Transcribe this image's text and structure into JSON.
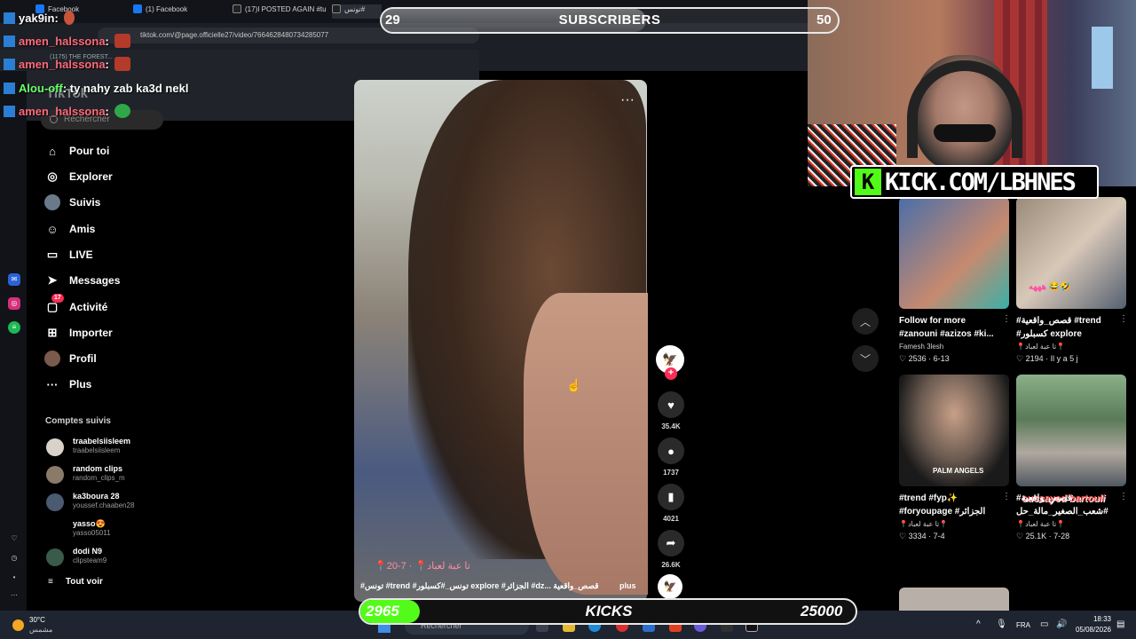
{
  "browser": {
    "tabs": [
      {
        "label": "Facebook",
        "color": "#1877f2"
      },
      {
        "label": "(1) Facebook",
        "color": "#1877f2"
      },
      {
        "label": "(17)I POSTED AGAIN #tu",
        "color": "#ffffff"
      },
      {
        "label": "تونس#",
        "color": "#ffffff"
      }
    ],
    "url": "tiktok.com/@page.officielle27/video/7664628480734285077",
    "bookmark": "(1175) THE FOREST..."
  },
  "chat": [
    {
      "user": "yak9in",
      "text": "",
      "user_color": "#ffffff",
      "emote_color": "#c8553a"
    },
    {
      "user": "amen_halssona",
      "text": "",
      "user_color": "#ff6a7a",
      "emote_color": "#b43a2a"
    },
    {
      "user": "amen_halssona",
      "text": "",
      "user_color": "#ff6a7a",
      "emote_color": "#b43a2a"
    },
    {
      "user": "Alou-off",
      "text": "ty nahy zab ka3d nekl",
      "user_color": "#6bff6b",
      "emote_color": ""
    },
    {
      "user": "amen_halssona",
      "text": "",
      "user_color": "#ff6a7a",
      "emote_color": "#2fa84a"
    }
  ],
  "overlay": {
    "subscribers": {
      "current": "29",
      "label": "SUBSCRIBERS",
      "goal": "50",
      "progress": 0.58
    },
    "kicks": {
      "current": "2965",
      "label": "KICKS",
      "goal": "25000",
      "progress": 0.12
    },
    "kick_url": "KICK.COM/LBHNES",
    "kick_logo": "K"
  },
  "tiktok": {
    "logo": "TikTok",
    "search_placeholder": "Rechercher",
    "nav": [
      {
        "icon": "home-icon",
        "glyph": "⌂",
        "label": "Pour toi"
      },
      {
        "icon": "compass-icon",
        "glyph": "◎",
        "label": "Explorer"
      },
      {
        "icon": "following-icon",
        "glyph": "●",
        "label": "Suivis"
      },
      {
        "icon": "friends-icon",
        "glyph": "☺",
        "label": "Amis"
      },
      {
        "icon": "live-icon",
        "glyph": "▭",
        "label": "LIVE"
      },
      {
        "icon": "messages-icon",
        "glyph": "➤",
        "label": "Messages"
      },
      {
        "icon": "activity-icon",
        "glyph": "▢",
        "label": "Activité",
        "badge": "17"
      },
      {
        "icon": "upload-icon",
        "glyph": "⊞",
        "label": "Importer"
      },
      {
        "icon": "profile-icon",
        "glyph": "●",
        "label": "Profil"
      },
      {
        "icon": "more-icon",
        "glyph": "···",
        "label": "Plus"
      }
    ],
    "following_title": "Comptes suivis",
    "accounts": [
      {
        "name": "traabelsiisleem",
        "handle": "traabelsiisleem",
        "color": "#d9d2c8"
      },
      {
        "name": "random clips",
        "handle": "random_clips_m",
        "color": "#8a7a6a"
      },
      {
        "name": "ka3boura 28",
        "handle": "youssef.chaaben28",
        "color": "#4a5a70"
      },
      {
        "name": "yasso😍",
        "handle": "yasso05011",
        "color": "#000000"
      },
      {
        "name": "dodi N9",
        "handle": "clipsteam9",
        "color": "#3a5a4a"
      }
    ],
    "see_all": "Tout voir",
    "video": {
      "caption": "📍تا عبة لعباد📍 · 7-20",
      "tags": "#تونس #trend #تونس_#كسبلور explore #الجزائر #dz... قصص_واقعية",
      "more": "plus",
      "likes": "35.4K",
      "comments": "1737",
      "saves": "4021",
      "shares": "26.6K"
    },
    "grid": [
      {
        "title": "Follow for more #zanouni #azizos #ki...",
        "author": "Famesh 3lesh",
        "stats": "♡ 2536 · 6-13",
        "thumb": "#4a6ea8",
        "cap": "",
        "cap_color": ""
      },
      {
        "title": "#قصص_واقعية #trend #كسبلور explore #الجزائر...",
        "author": "📍تا عبة لعباد📍",
        "stats": "♡ 2194 · Il y a 5 j",
        "thumb": "#9a8a78",
        "cap": "هههه 😂🤣",
        "cap_color": "#ff4aa0"
      },
      {
        "title": "#trend #fyp✨ #foryoupage #الجزائر dz...",
        "author": "📍تا عبة لعباد📍",
        "stats": "♡ 3334 · 7-4",
        "thumb": "#6a5a50",
        "cap": "PALM ANGELS",
        "cap_color": "#ffffff"
      },
      {
        "title": "#قصص_واقعية #شعب_الصغير_مالة_حل 🥹...",
        "author": "📍تا عبة لعباد📍",
        "stats": "♡ 25.1K · 7-28",
        "thumb": "#5a7a58",
        "cap": "oussayed bartouli",
        "cap_color": "#ff4a4a"
      }
    ]
  },
  "taskbar": {
    "temp": "30°C",
    "weather": "مشمس",
    "search": "Rechercher",
    "lang": "FRA",
    "time": "18:33",
    "date": "05/08/2026"
  }
}
